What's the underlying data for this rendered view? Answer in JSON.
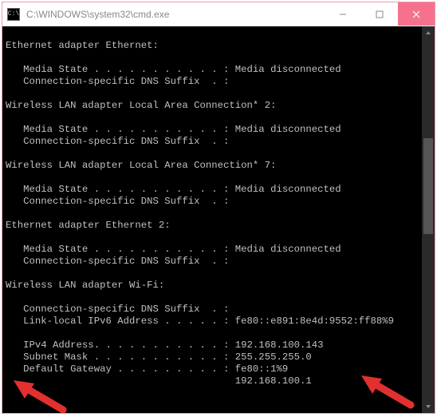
{
  "window": {
    "title": "C:\\WINDOWS\\system32\\cmd.exe",
    "icon_glyph": "C:\\"
  },
  "adapters": [
    {
      "header": "Ethernet adapter Ethernet:",
      "lines": [
        {
          "label": "Media State . . . . . . . . . . . :",
          "value": "Media disconnected"
        },
        {
          "label": "Connection-specific DNS Suffix  . :",
          "value": ""
        }
      ]
    },
    {
      "header": "Wireless LAN adapter Local Area Connection* 2:",
      "lines": [
        {
          "label": "Media State . . . . . . . . . . . :",
          "value": "Media disconnected"
        },
        {
          "label": "Connection-specific DNS Suffix  . :",
          "value": ""
        }
      ]
    },
    {
      "header": "Wireless LAN adapter Local Area Connection* 7:",
      "lines": [
        {
          "label": "Media State . . . . . . . . . . . :",
          "value": "Media disconnected"
        },
        {
          "label": "Connection-specific DNS Suffix  . :",
          "value": ""
        }
      ]
    },
    {
      "header": "Ethernet adapter Ethernet 2:",
      "lines": [
        {
          "label": "Media State . . . . . . . . . . . :",
          "value": "Media disconnected"
        },
        {
          "label": "Connection-specific DNS Suffix  . :",
          "value": ""
        }
      ]
    },
    {
      "header": "Wireless LAN adapter Wi-Fi:",
      "lines": [
        {
          "label": "Connection-specific DNS Suffix  . :",
          "value": ""
        },
        {
          "label": "Link-local IPv6 Address . . . . . :",
          "value": "fe80::e891:8e4d:9552:ff88%9"
        },
        {
          "label": "",
          "value": ""
        },
        {
          "label": "IPv4 Address. . . . . . . . . . . :",
          "value": "192.168.100.143"
        },
        {
          "label": "Subnet Mask . . . . . . . . . . . :",
          "value": "255.255.255.0"
        },
        {
          "label": "Default Gateway . . . . . . . . . :",
          "value": "fe80::1%9"
        },
        {
          "label": "                                   ",
          "value": "192.168.100.1"
        }
      ]
    }
  ],
  "annotation": {
    "color": "#e2302f"
  }
}
